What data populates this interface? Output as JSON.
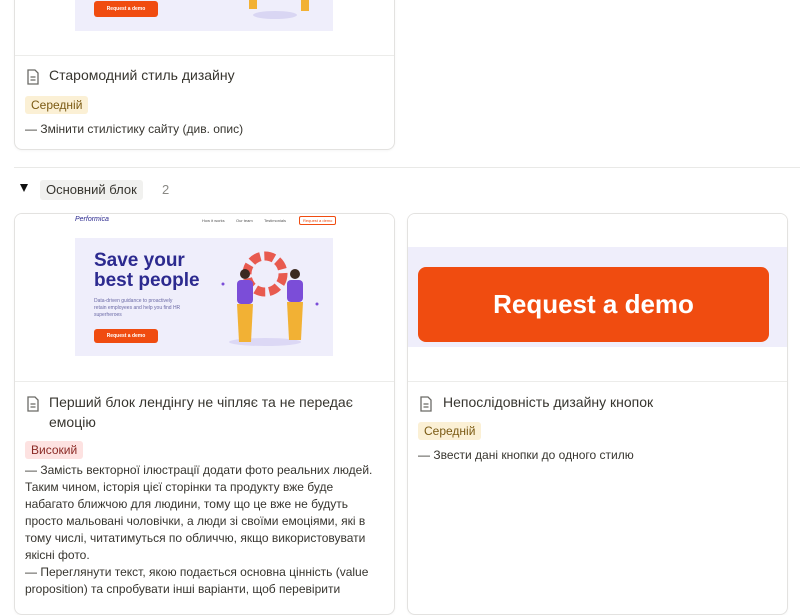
{
  "top_card": {
    "cover_button": "Request a demo",
    "title": "Старомодний стиль дизайну",
    "priority": "Середній",
    "description": "— Змінити стилістику сайту (див. опис)"
  },
  "group": {
    "name": "Основний блок",
    "count": "2"
  },
  "cards": [
    {
      "cover": {
        "logo": "Performica",
        "nav": [
          "How it works",
          "Our team",
          "Testimonials",
          "Request a demo"
        ],
        "headline_1": "Save your",
        "headline_2": "best people",
        "subtext": "Data-driven guidance to proactively retain employees and help you find HR superheroes",
        "button": "Request a demo"
      },
      "title": "Перший блок лендінгу не чіпляє та не передає емоцію",
      "priority": "Високий",
      "description": "— Замість векторної ілюстрації додати фото реальних людей. Таким чином, історія цієї сторінки та продукту вже буде набагато ближчою для людини, тому що це вже не будуть просто мальовані чоловічки, а люди зі своїми емоціями, які в тому числі, читатимуться по обличчю, якщо використовувати якісні фото.\n— Переглянути текст, якою подається основна цінність (value proposition) та спробувати інші варіанти, щоб перевірити"
    },
    {
      "cover": {
        "button": "Request a demo"
      },
      "title": "Непослідовність дизайну кнопок",
      "priority": "Середній",
      "description": "— Звести дані кнопки до одного стилю"
    }
  ],
  "colors": {
    "accent_orange": "#f04c10",
    "banner_lavender": "#efeefb",
    "tag_medium_bg": "#fbf0d5",
    "tag_high_bg": "#fde2e1"
  }
}
